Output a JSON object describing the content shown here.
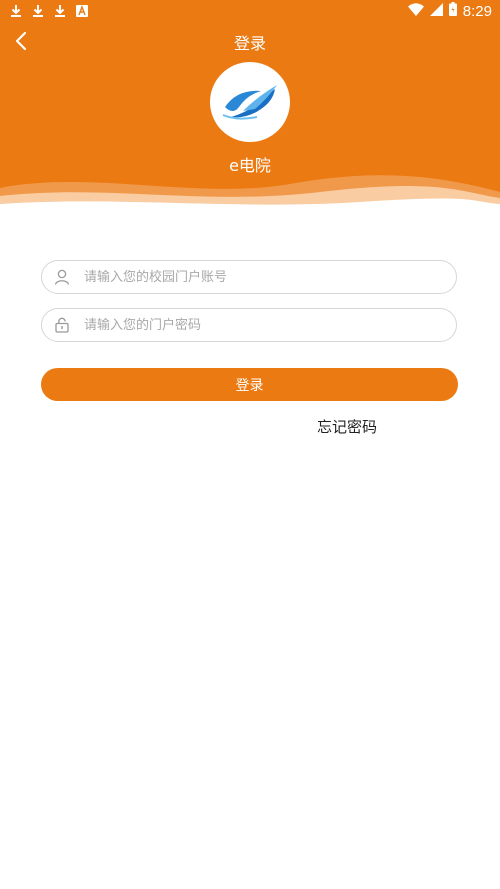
{
  "status_bar": {
    "time": "8:29",
    "left_icons": [
      "download-icon",
      "download-icon",
      "download-icon",
      "font-icon"
    ],
    "right_icons": [
      "wifi-icon",
      "signal-icon",
      "battery-icon"
    ]
  },
  "header": {
    "title": "登录",
    "app_name": "e电院",
    "background_color": "#ec7a12"
  },
  "form": {
    "username_placeholder": "请输入您的校园门户账号",
    "password_placeholder": "请输入您的门户密码",
    "login_label": "登录",
    "forgot_label": "忘记密码"
  },
  "colors": {
    "accent": "#ec7a12",
    "logo_blue": "#1a7fd0"
  }
}
